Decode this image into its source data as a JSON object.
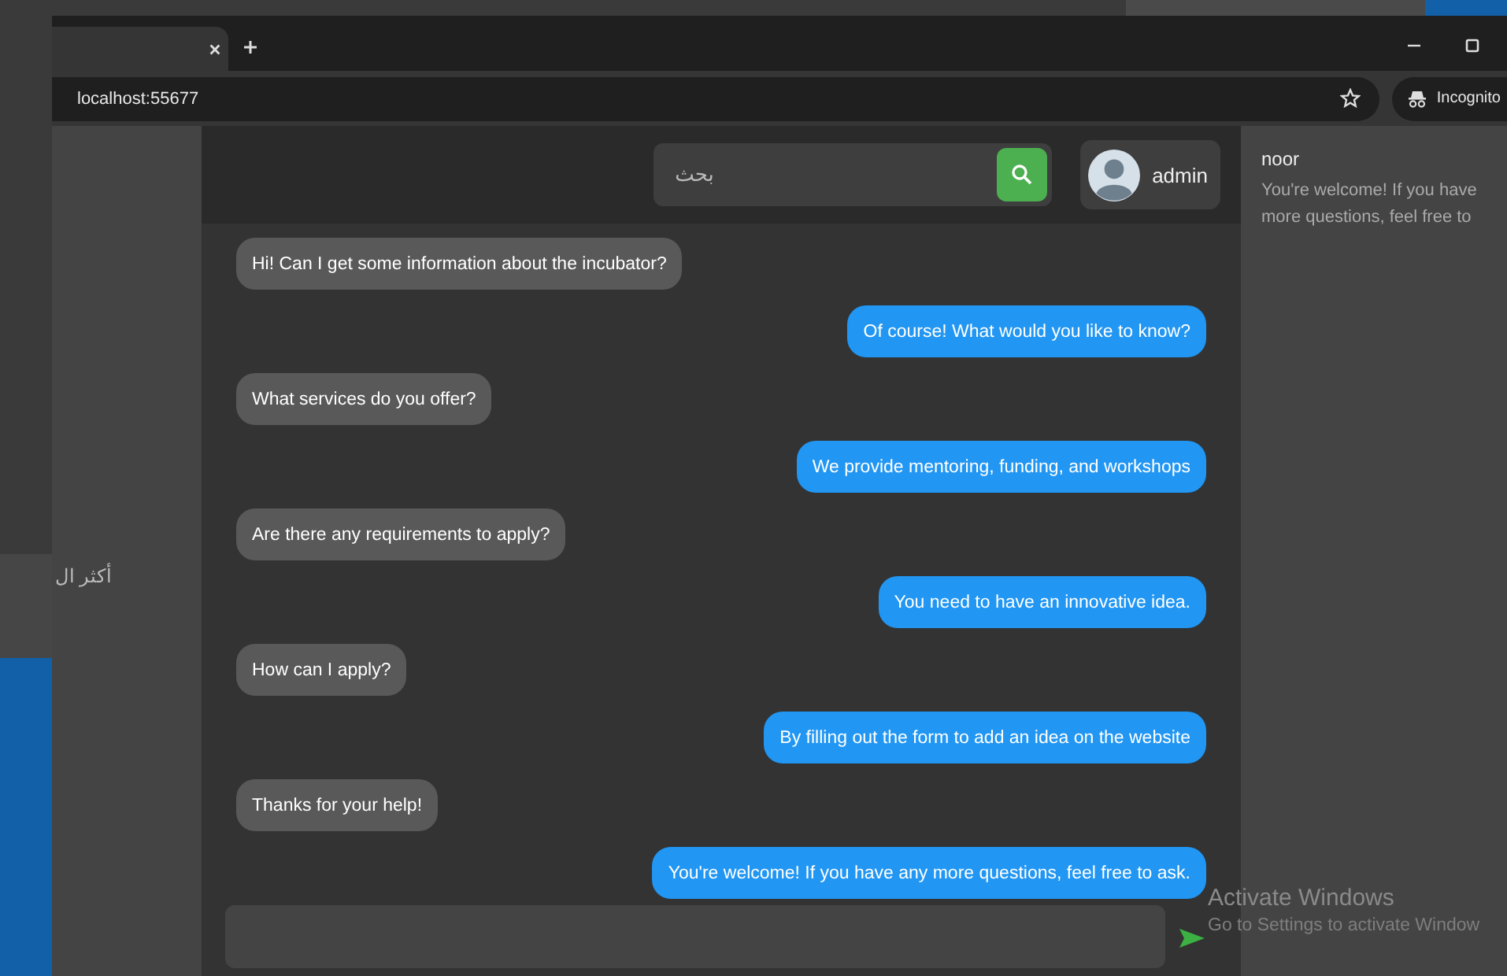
{
  "browser": {
    "address": "localhost:55677",
    "incognito_label": "Incognito"
  },
  "sidebar": {
    "items": [
      {
        "label": "أكثر ال"
      }
    ]
  },
  "search": {
    "placeholder": "بحث"
  },
  "user": {
    "name": "admin"
  },
  "messages": [
    {
      "kind": "received",
      "text": "Hi! Can I get some information about the incubator?"
    },
    {
      "kind": "sent",
      "text": "Of course! What would you like to know?"
    },
    {
      "kind": "received",
      "text": "What services do you offer?"
    },
    {
      "kind": "sent",
      "text": "We provide mentoring, funding, and workshops"
    },
    {
      "kind": "received",
      "text": "Are there any requirements to apply?"
    },
    {
      "kind": "sent",
      "text": "You need to have an innovative idea."
    },
    {
      "kind": "received",
      "text": "How can I apply?"
    },
    {
      "kind": "sent",
      "text": "By filling out the form to add an idea on the website"
    },
    {
      "kind": "received",
      "text": "Thanks for your help!"
    },
    {
      "kind": "sent",
      "text": "You're welcome! If you have any more questions, feel free to ask."
    }
  ],
  "conversations": [
    {
      "name": "noor",
      "preview": "You're welcome! If you have more questions, feel free to"
    }
  ],
  "os_notice": {
    "title": "Activate Windows",
    "subtitle": "Go to Settings to activate Window"
  }
}
